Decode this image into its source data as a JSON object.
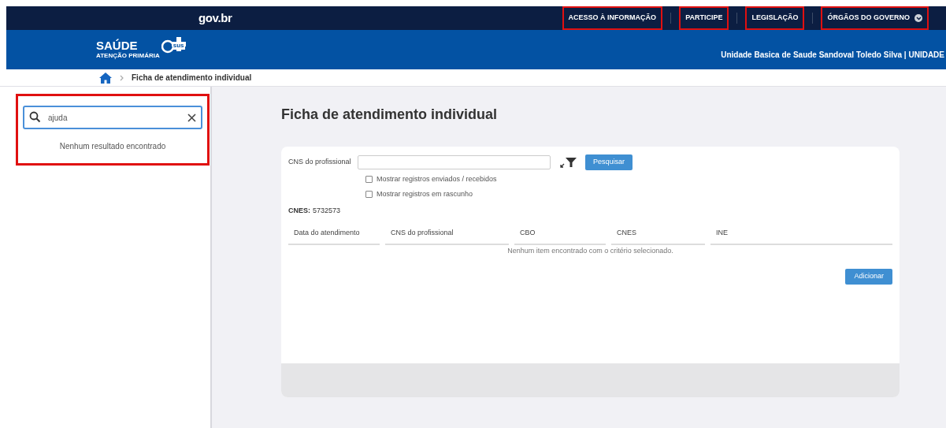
{
  "top_bar": {
    "logo": "gov.br",
    "links": [
      {
        "label": "ACESSO À INFORMAÇÃO",
        "highlighted": true
      },
      {
        "label": "PARTICIPE",
        "highlighted": true
      },
      {
        "label": "LEGISLAÇÃO",
        "highlighted": true
      },
      {
        "label": "ÓRGÃOS DO GOVERNO",
        "highlighted": true,
        "dropdown": true
      }
    ]
  },
  "header": {
    "brand": "SAÚDE",
    "badge": "sus",
    "tagline": "ATENÇÃO PRIMÁRIA",
    "unit": "Unidade Basica de Saude Sandoval Toledo Silva | UNIDADE"
  },
  "breadcrumb": {
    "current": "Ficha de atendimento individual"
  },
  "sidebar": {
    "highlighted": true,
    "search": {
      "value": "ajuda"
    },
    "empty_message": "Nenhum resultado encontrado"
  },
  "main": {
    "title": "Ficha de atendimento individual",
    "form": {
      "field_label": "CNS do profissional",
      "search_button": "Pesquisar",
      "checkboxes": [
        {
          "label": "Mostrar registros enviados / recebidos",
          "checked": false
        },
        {
          "label": "Mostrar registros em rascunho",
          "checked": false
        }
      ],
      "cnes_label": "CNES:",
      "cnes_value": "5732573"
    },
    "table": {
      "columns": [
        "Data do atendimento",
        "CNS do profissional",
        "CBO",
        "CNES",
        "INE"
      ],
      "empty_message": "Nenhum item encontrado com o critério selecionado."
    },
    "add_button": "Adicionar"
  }
}
